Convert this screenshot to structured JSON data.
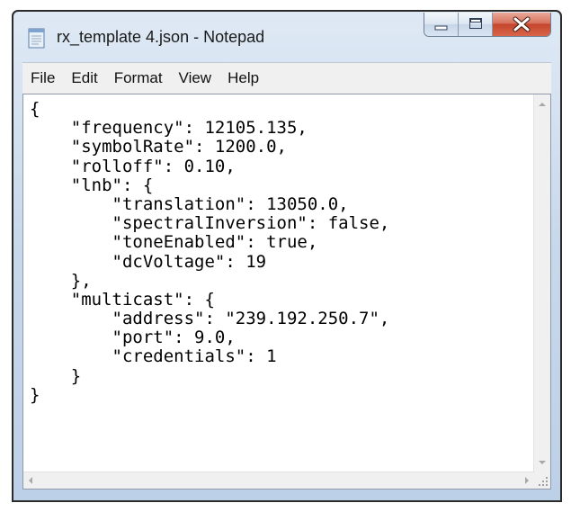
{
  "window": {
    "title": "rx_template 4.json - Notepad",
    "icons": {
      "app": "notepad-icon",
      "minimize": "minimize-icon",
      "maximize": "maximize-icon",
      "close": "close-icon"
    }
  },
  "menu": {
    "items": [
      "File",
      "Edit",
      "Format",
      "View",
      "Help"
    ]
  },
  "editor": {
    "lines": [
      "{",
      "    \"frequency\": 12105.135,",
      "    \"symbolRate\": 1200.0,",
      "    \"rolloff\": 0.10,",
      "    \"lnb\": {",
      "        \"translation\": 13050.0,",
      "        \"spectralInversion\": false,",
      "        \"toneEnabled\": true,",
      "        \"dcVoltage\": 19",
      "    },",
      "    \"multicast\": {",
      "        \"address\": \"239.192.250.7\",",
      "        \"port\": 9.0,",
      "        \"credentials\": 1",
      "    }",
      "}"
    ]
  },
  "colors": {
    "close_button": "#c4462c",
    "frame": "#c9d9ec"
  }
}
